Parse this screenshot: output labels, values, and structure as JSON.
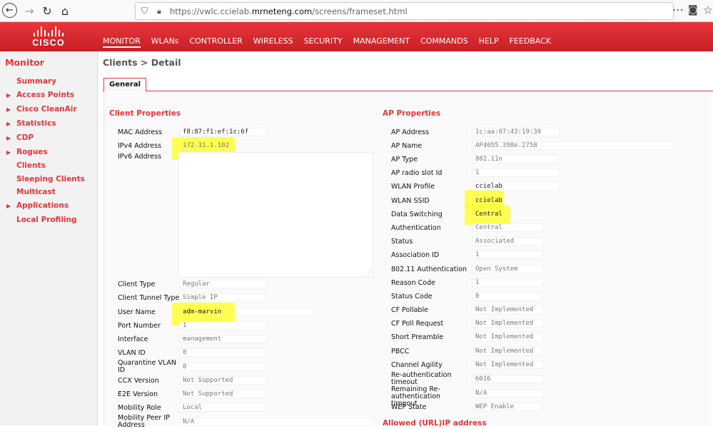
{
  "browser": {
    "url_prefix": "https://vwlc.ccielab.",
    "url_domain": "mrneteng.com",
    "url_suffix": "/screens/frameset.html",
    "back_icon": "←",
    "forward_icon": "→",
    "reload_icon": "↻",
    "home_icon": "⌂",
    "more_icon": "⋯",
    "pocket_icon": "◙",
    "star_icon": "☆"
  },
  "brand": {
    "name": "CISCO"
  },
  "top_nav": [
    {
      "label": "MONITOR",
      "active": true
    },
    {
      "label": "WLANs"
    },
    {
      "label": "CONTROLLER"
    },
    {
      "label": "WIRELESS"
    },
    {
      "label": "SECURITY"
    },
    {
      "label": "MANAGEMENT"
    },
    {
      "label": "COMMANDS"
    },
    {
      "label": "HELP"
    },
    {
      "label": "FEEDBACK"
    }
  ],
  "sidebar": {
    "title": "Monitor",
    "items": [
      {
        "label": "Summary",
        "expandable": false
      },
      {
        "label": "Access Points",
        "expandable": true
      },
      {
        "label": "Cisco CleanAir",
        "expandable": true
      },
      {
        "label": "Statistics",
        "expandable": true
      },
      {
        "label": "CDP",
        "expandable": true
      },
      {
        "label": "Rogues",
        "expandable": true
      },
      {
        "label": "Clients",
        "expandable": false
      },
      {
        "label": "Sleeping Clients",
        "expandable": false
      },
      {
        "label": "Multicast",
        "expandable": false
      },
      {
        "label": "Applications",
        "expandable": true
      },
      {
        "label": "Local Profiling",
        "expandable": false
      }
    ]
  },
  "page": {
    "title": "Clients > Detail",
    "tab": "General"
  },
  "client_properties": {
    "title": "Client Properties",
    "mac_label": "MAC Address",
    "mac_value": "f8:87:f1:ef:1c:6f",
    "ipv4_label": "IPv4 Address",
    "ipv4_value": "172.31.1.102",
    "ipv6_label": "IPv6 Address",
    "client_type_label": "Client Type",
    "client_type_value": "Regular",
    "tunnel_type_label": "Client Tunnel Type",
    "tunnel_type_value": "Simple IP",
    "user_name_label": "User Name",
    "user_name_value": "adm-marvin",
    "port_label": "Port Number",
    "port_value": "1",
    "interface_label": "Interface",
    "interface_value": "management",
    "vlan_label": "VLAN ID",
    "vlan_value": "0",
    "quarantine_label": "Quarantine VLAN ID",
    "quarantine_value": "0",
    "ccx_label": "CCX Version",
    "ccx_value": "Not Supported",
    "e2e_label": "E2E Version",
    "e2e_value": "Not Supported",
    "mobility_role_label": "Mobility Role",
    "mobility_role_value": "Local",
    "mobility_peer_label": "Mobility Peer IP Address",
    "mobility_peer_value": "N/A"
  },
  "ap_properties": {
    "title": "AP Properties",
    "ap_address_label": "AP Address",
    "ap_address_value": "1c:aa:07:43:19:30",
    "ap_name_label": "AP Name",
    "ap_name_value": "AP4055.398e.2758",
    "ap_type_label": "AP Type",
    "ap_type_value": "802.11n",
    "radio_slot_label": "AP radio slot Id",
    "radio_slot_value": "1",
    "wlan_profile_label": "WLAN Profile",
    "wlan_profile_value": "ccielab",
    "wlan_ssid_label": "WLAN SSID",
    "wlan_ssid_value": "ccielab",
    "data_switching_label": "Data Switching",
    "data_switching_value": "Central",
    "authentication_label": "Authentication",
    "authentication_value": "Central",
    "status_label": "Status",
    "status_value": "Associated",
    "association_id_label": "Association ID",
    "association_id_value": "1",
    "dot11_auth_label": "802.11 Authentication",
    "dot11_auth_value": "Open System",
    "reason_code_label": "Reason Code",
    "reason_code_value": "1",
    "status_code_label": "Status Code",
    "status_code_value": "0",
    "cf_pollable_label": "CF Pollable",
    "cf_pollable_value": "Not Implemented",
    "cf_poll_request_label": "CF Poll Request",
    "cf_poll_request_value": "Not Implemented",
    "short_preamble_label": "Short Preamble",
    "short_preamble_value": "Not Implemented",
    "pbcc_label": "PBCC",
    "pbcc_value": "Not Implemented",
    "channel_agility_label": "Channel Agility",
    "channel_agility_value": "Not Implemented",
    "reauth_timeout_label": "Re-authentication timeout",
    "reauth_timeout_value": "6016",
    "remaining_reauth_label": "Remaining Re-authentication timeout",
    "remaining_reauth_value": "N/A",
    "wep_state_label": "WEP State",
    "wep_state_value": "WEP Enable"
  },
  "allowed_section": {
    "title": "Allowed (URL)IP address"
  },
  "colors": {
    "accent": "#e2363b",
    "header": "#d2262c",
    "highlight": "#ffff33"
  }
}
